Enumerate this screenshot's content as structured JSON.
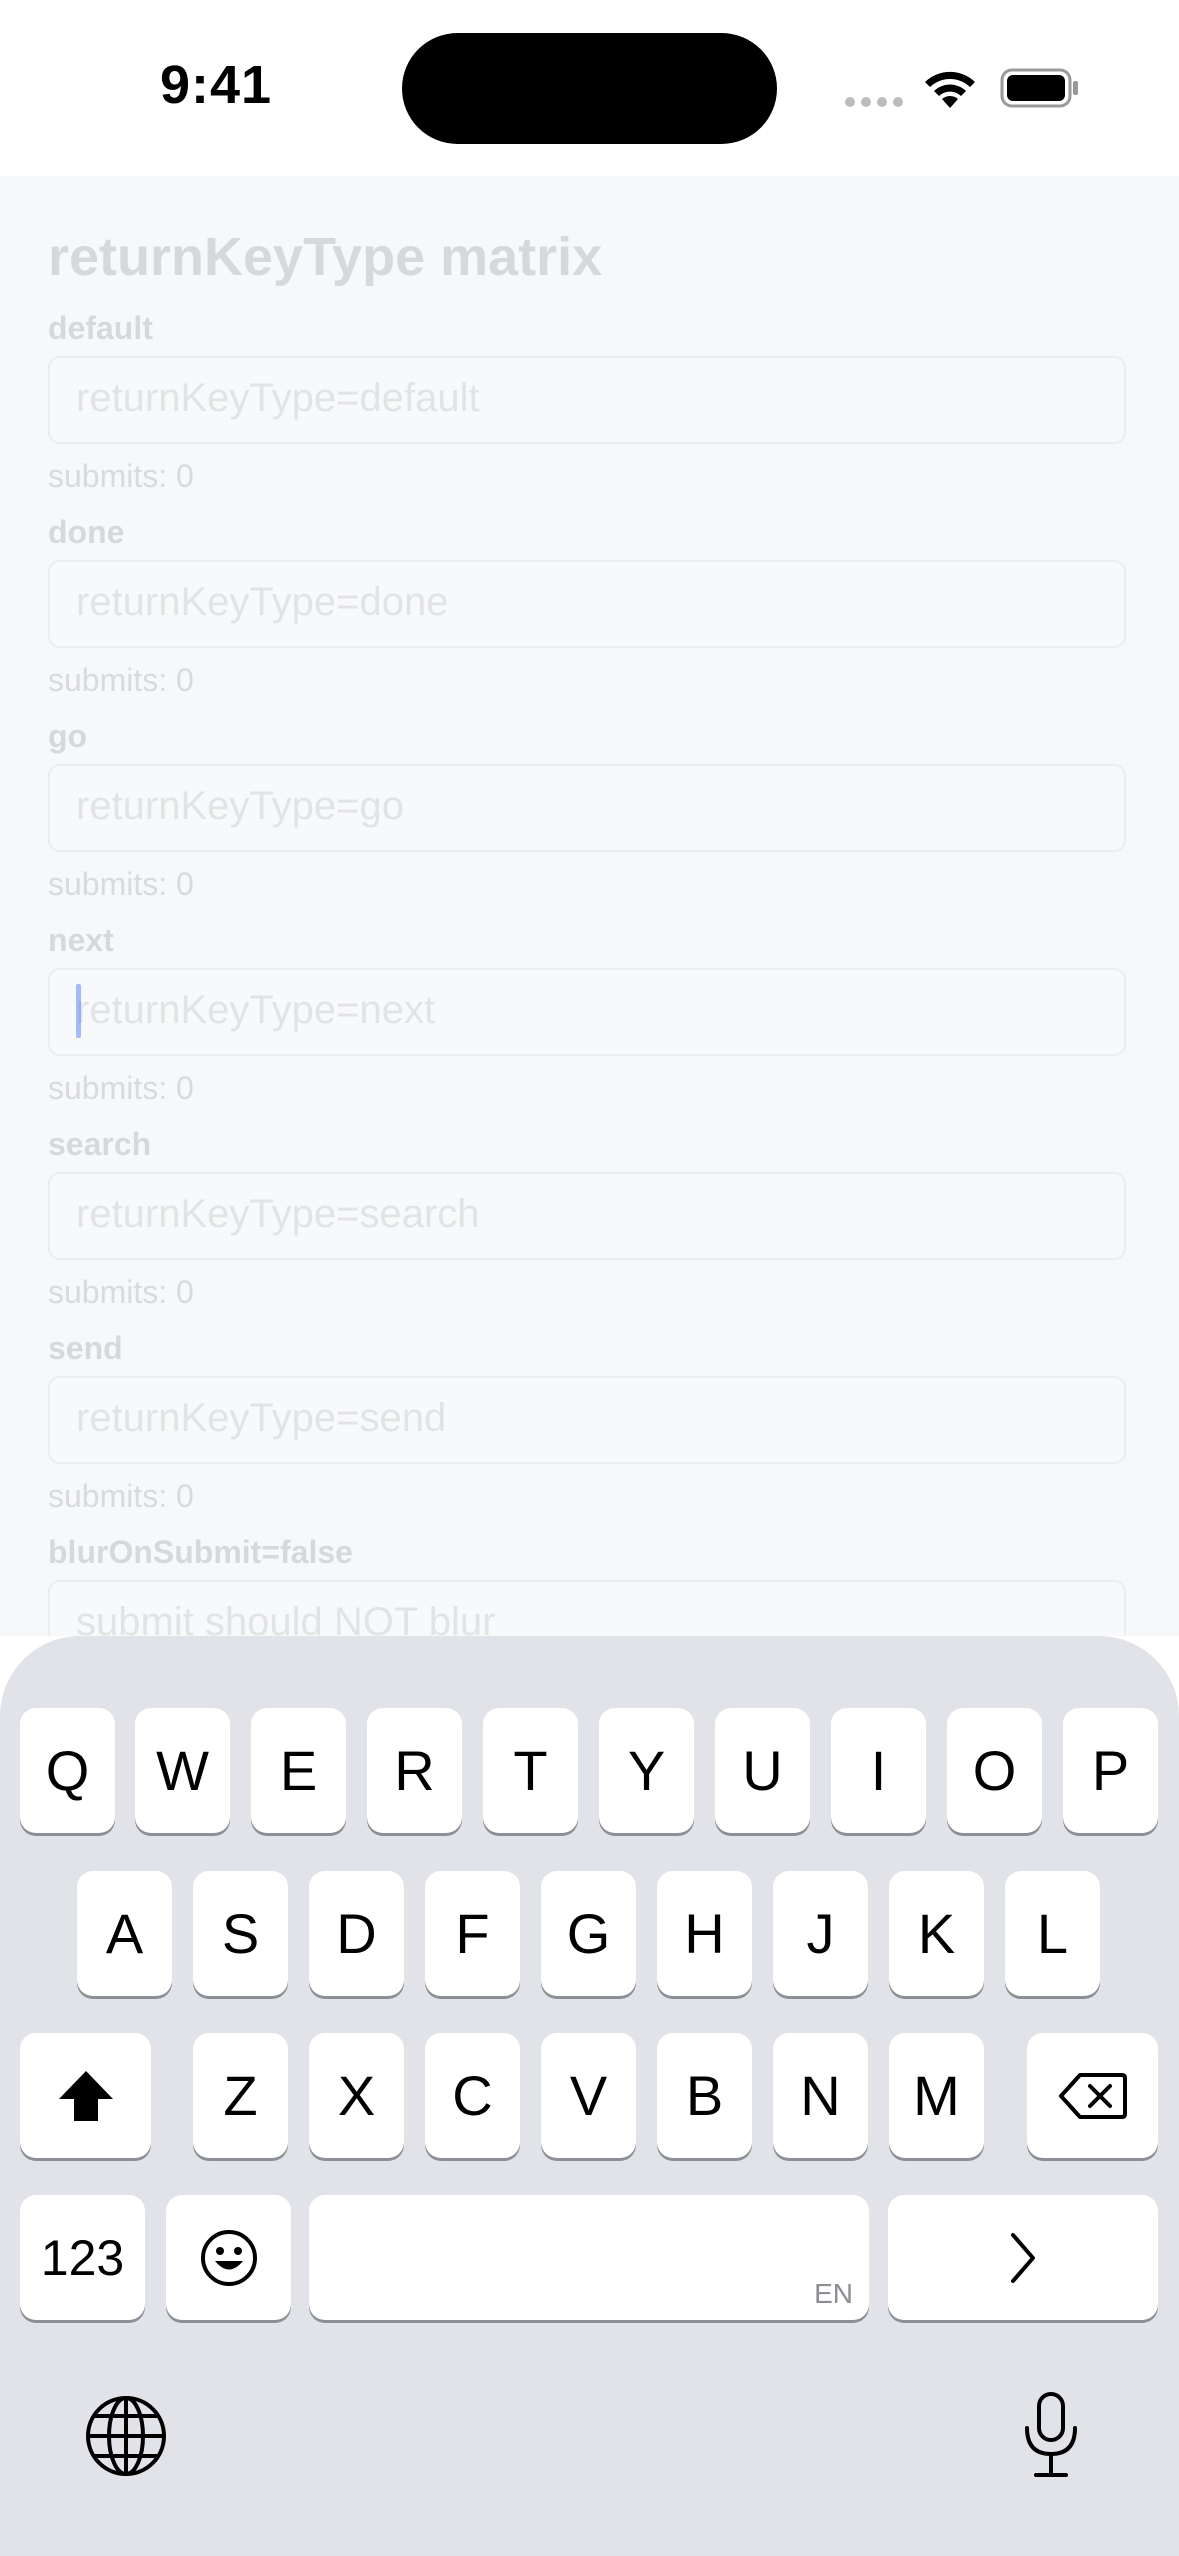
{
  "status_bar": {
    "time": "9:41"
  },
  "screen": {
    "title": "returnKeyType matrix",
    "rows": [
      {
        "label": "default",
        "placeholder": "returnKeyType=default",
        "submits": "submits: 0"
      },
      {
        "label": "done",
        "placeholder": "returnKeyType=done",
        "submits": "submits: 0"
      },
      {
        "label": "go",
        "placeholder": "returnKeyType=go",
        "submits": "submits: 0"
      },
      {
        "label": "next",
        "placeholder": "returnKeyType=next",
        "submits": "submits: 0"
      },
      {
        "label": "search",
        "placeholder": "returnKeyType=search",
        "submits": "submits: 0"
      },
      {
        "label": "send",
        "placeholder": "returnKeyType=send",
        "submits": "submits: 0"
      },
      {
        "label": "blurOnSubmit=false",
        "placeholder": "submit should NOT blur"
      }
    ],
    "focused_row": "next"
  },
  "keyboard": {
    "row1": [
      "Q",
      "W",
      "E",
      "R",
      "T",
      "Y",
      "U",
      "I",
      "O",
      "P"
    ],
    "row2": [
      "A",
      "S",
      "D",
      "F",
      "G",
      "H",
      "J",
      "K",
      "L"
    ],
    "row3": [
      "Z",
      "X",
      "C",
      "V",
      "B",
      "N",
      "M"
    ],
    "numbers_key": "123",
    "space_language": "EN",
    "icons": {
      "shift": "shift-icon",
      "delete": "delete-icon",
      "emoji": "emoji-icon",
      "return": "next-arrow-icon",
      "globe": "globe-icon",
      "mic": "microphone-icon"
    }
  },
  "colors": {
    "keyboard_bg": "#e1e3e8",
    "key_bg": "#ffffff",
    "caret": "#3b6cff"
  }
}
